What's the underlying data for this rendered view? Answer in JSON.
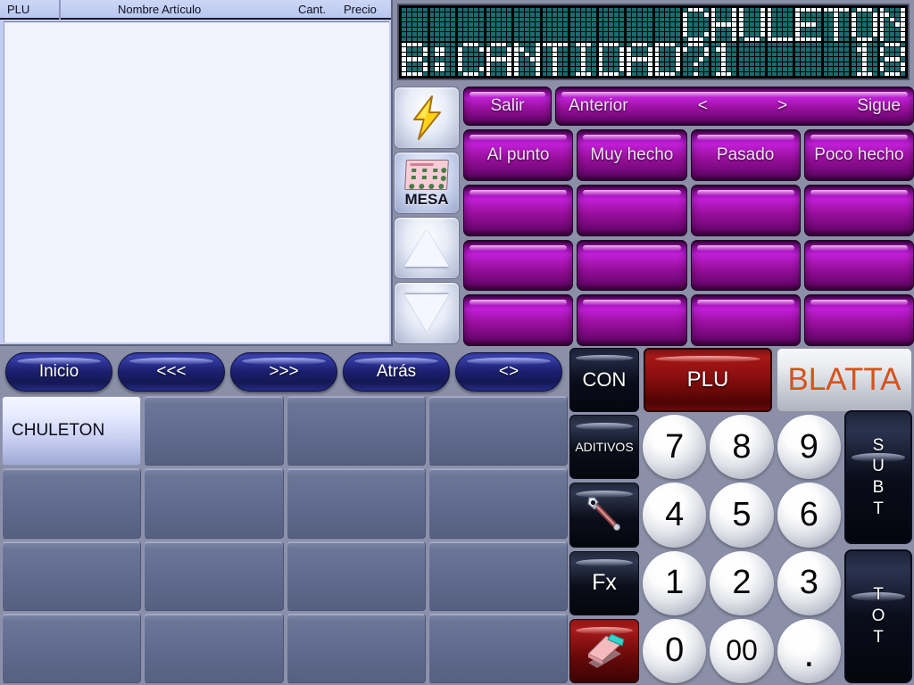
{
  "ticket": {
    "columns": [
      "PLU",
      "Nombre Artículo",
      "Cant.",
      "Precio"
    ],
    "rows": []
  },
  "display": {
    "columns": 18,
    "line1": "          CHULETON",
    "line2": "B:CANTIDAD?1    18"
  },
  "side_column": {
    "lightning_icon": "lightning-bolt-icon",
    "mesa_label": "MESA",
    "mesa_icon": "table-layout-icon",
    "up_icon": "triangle-up-icon",
    "down_icon": "triangle-down-icon"
  },
  "modifiers": {
    "exit_label": "Salir",
    "nav_prev": "Anterior",
    "nav_left": "<",
    "nav_right": ">",
    "nav_next": "Sigue",
    "buttons": [
      "Al punto",
      "Muy hecho",
      "Pasado",
      "Poco hecho",
      "",
      "",
      "",
      "",
      "",
      "",
      "",
      "",
      "",
      "",
      "",
      ""
    ]
  },
  "navbar": {
    "buttons": [
      "Inicio",
      "<<<",
      ">>>",
      "Atrás",
      "<>"
    ]
  },
  "product_grid": {
    "cells": [
      "CHULETON",
      "",
      "",
      "",
      "",
      "",
      "",
      "",
      "",
      "",
      "",
      "",
      "",
      "",
      "",
      ""
    ]
  },
  "controls": {
    "con_label": "CON",
    "plu_label": "PLU",
    "brand_label": "BLATTA",
    "aditivos_label": "ADITIVOS",
    "wrench_icon": "wrench-icon",
    "fx_label": "Fx",
    "eraser_icon": "eraser-icon",
    "subtotal_label": "SUBT",
    "total_label": "TOT"
  },
  "keypad": {
    "keys": [
      "7",
      "8",
      "9",
      "4",
      "5",
      "6",
      "1",
      "2",
      "3",
      "0",
      "00",
      "."
    ]
  },
  "colors": {
    "background": "#8b90a8",
    "purple_button": "#a313b8",
    "nav_button": "#1b2070",
    "plu_red": "#a51818",
    "brand_orange": "#d4531e",
    "display_dot_off": "#1c6b70",
    "display_dot_on": "#f2fbfb",
    "product_cell": "#5f6a8d"
  }
}
